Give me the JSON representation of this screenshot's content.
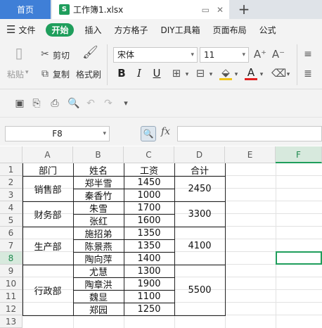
{
  "tabs": {
    "home": "首页",
    "doc_icon": "S",
    "doc_title": "工作簿1.xlsx",
    "new_tab": "+"
  },
  "menu": {
    "file": "文件",
    "items": [
      "开始",
      "插入",
      "方方格子",
      "DIY工具箱",
      "页面布局",
      "公式"
    ]
  },
  "ribbon": {
    "paste": "粘贴",
    "cut": "剪切",
    "copy": "复制",
    "format_painter": "格式刷",
    "font_name": "宋体",
    "font_size": "11",
    "bold": "B",
    "italic": "I",
    "underline": "U",
    "font_color_letter": "A",
    "grow_font": "A⁺",
    "shrink_font": "A⁻"
  },
  "formula_bar": {
    "name_box": "F8",
    "fx": "fx",
    "value": ""
  },
  "columns": [
    "A",
    "B",
    "C",
    "D",
    "E",
    "F"
  ],
  "selected_column": "F",
  "rows": [
    "1",
    "2",
    "3",
    "4",
    "5",
    "6",
    "7",
    "8",
    "9",
    "10",
    "11",
    "12",
    "13"
  ],
  "selected_row": "8",
  "table": {
    "headers": [
      "部门",
      "姓名",
      "工资",
      "合计"
    ],
    "groups": [
      {
        "dept": "销售部",
        "total": "2450",
        "people": [
          [
            "郑半雪",
            "1450"
          ],
          [
            "秦香竹",
            "1000"
          ]
        ]
      },
      {
        "dept": "财务部",
        "total": "3300",
        "people": [
          [
            "朱雪",
            "1700"
          ],
          [
            "张红",
            "1600"
          ]
        ]
      },
      {
        "dept": "生产部",
        "total": "4100",
        "people": [
          [
            "施招弟",
            "1350"
          ],
          [
            "陈景燕",
            "1350"
          ],
          [
            "陶向萍",
            "1400"
          ]
        ]
      },
      {
        "dept": "行政部",
        "total": "5500",
        "people": [
          [
            "尤慧",
            "1300"
          ],
          [
            "陶章洪",
            "1900"
          ],
          [
            "魏显",
            "1100"
          ],
          [
            "郑园",
            "1250"
          ]
        ]
      }
    ]
  },
  "colors": {
    "accent": "#1f9e5c",
    "home_tab": "#3f7fd7"
  }
}
